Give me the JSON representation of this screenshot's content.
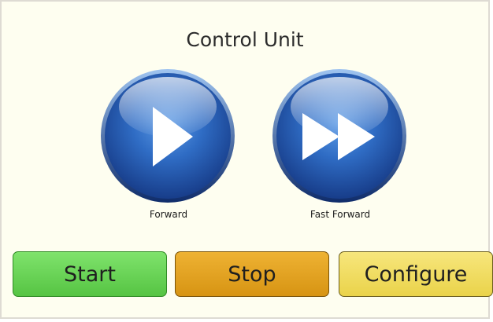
{
  "title": "Control Unit",
  "media": {
    "forward": {
      "label": "Forward",
      "icon": "play-icon"
    },
    "fast_forward": {
      "label": "Fast Forward",
      "icon": "fast-forward-icon"
    }
  },
  "actions": {
    "start": {
      "label": "Start",
      "color": "#6ad657"
    },
    "stop": {
      "label": "Stop",
      "color": "#e6a525"
    },
    "configure": {
      "label": "Configure",
      "color": "#f1dd63"
    }
  },
  "colors": {
    "background": "#fefef0",
    "button_blue": "#2a62b8"
  }
}
